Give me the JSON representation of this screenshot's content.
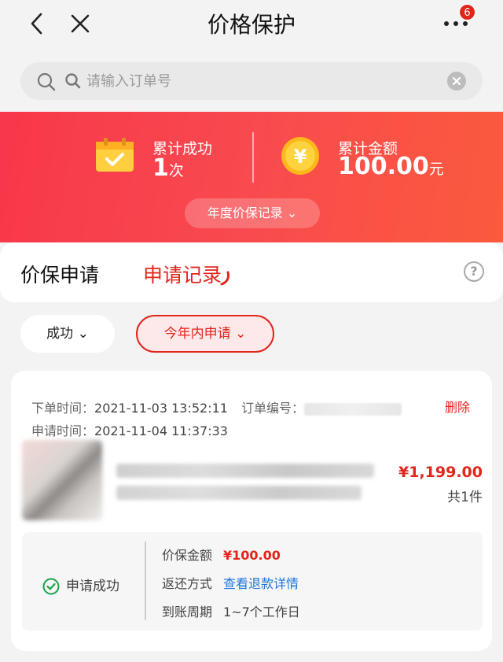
{
  "nav": {
    "title": "价格保护",
    "badge": "6"
  },
  "search": {
    "placeholder": "请输入订单号"
  },
  "hero": {
    "success_label": "累计成功",
    "success_value": "1",
    "success_unit": "次",
    "amount_label": "累计金额",
    "amount_value": "100.00",
    "amount_unit": "元",
    "currency_icon": "¥",
    "year_button": "年度价保记录"
  },
  "tabs": {
    "apply": "价保申请",
    "records": "申请记录",
    "help": "?"
  },
  "filters": {
    "status": "成功",
    "period": "今年内申请"
  },
  "order": {
    "order_time_label": "下单时间：",
    "order_time": "2021-11-03 13:52:11",
    "order_no_label": "订单编号：",
    "apply_time_label": "申请时间：",
    "apply_time": "2021-11-04 11:37:33",
    "delete": "删除",
    "price": "¥1,199.00",
    "qty": "共1件",
    "status": "申请成功",
    "protect_amount_label": "价保金额",
    "protect_amount": "¥100.00",
    "refund_method_label": "返还方式",
    "refund_method": "查看退款详情",
    "arrival_label": "到账周期",
    "arrival": "1~7个工作日"
  },
  "colors": {
    "accent": "#e1251b",
    "link": "#1d76db"
  }
}
